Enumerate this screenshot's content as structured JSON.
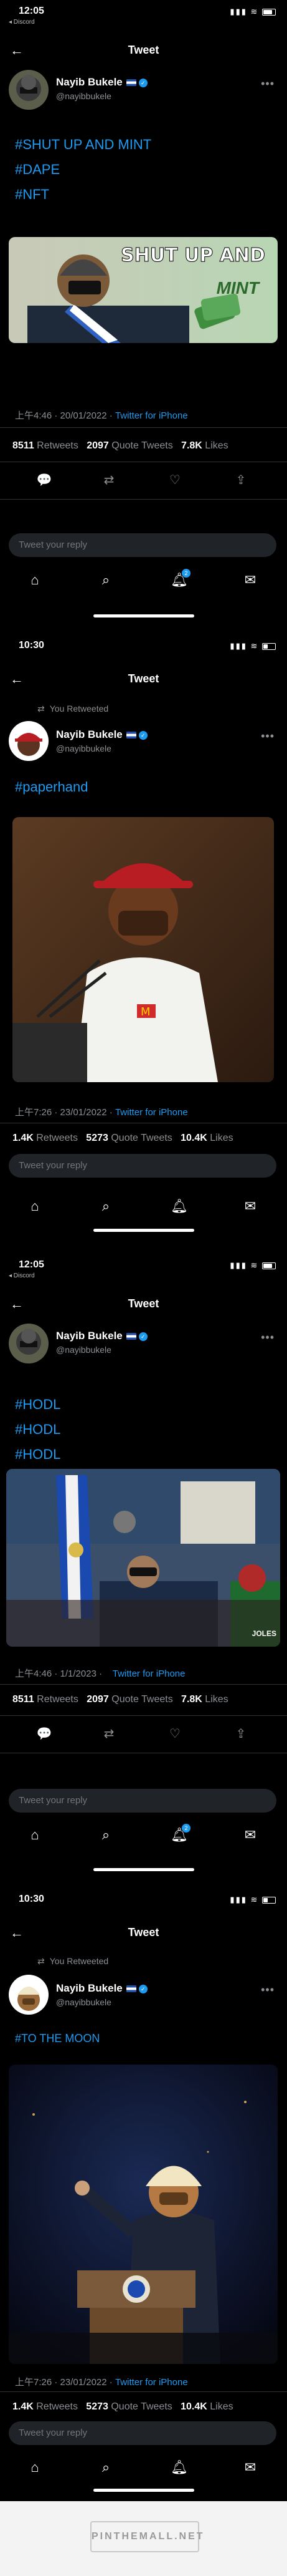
{
  "app": {
    "title": "Tweet",
    "reply_placeholder": "Tweet your reply"
  },
  "icons": {
    "back": "back-arrow-icon",
    "reply": "reply-icon",
    "retweet": "retweet-icon",
    "like": "heart-icon",
    "share": "share-icon",
    "home": "home-icon",
    "search": "search-icon",
    "notifications": "bell-icon",
    "messages": "mail-icon"
  },
  "colors": {
    "link": "#1d9bf0",
    "background": "#000000",
    "secondary_text": "#8b8f94"
  },
  "panels": [
    {
      "status_time": "12:05",
      "back_app": "◂ Discord",
      "retweeted": "",
      "name": "Nayib Bukele",
      "handle": "@nayibbukele",
      "hashtags": [
        "#SHUT UP AND MINT",
        "#DAPE",
        "#NFT"
      ],
      "image_caption_1": "SHUT UP AND",
      "image_caption_2": "MINT",
      "timestamp": "上午4:46 · 20/01/2022 ·",
      "source": "Twitter for iPhone",
      "retweets": "8511",
      "retweets_label": "Retweets",
      "quotes": "2097",
      "quotes_label": "Quote Tweets",
      "likes": "7.8K",
      "likes_label": "Likes",
      "notif_badge": "2"
    },
    {
      "status_time": "10:30",
      "retweeted": "You Retweeted",
      "name": "Nayib Bukele",
      "handle": "@nayibbukele",
      "hashtags": [
        "#paperhand"
      ],
      "timestamp": "上午7:26 · 23/01/2022 ·",
      "source": "Twitter for iPhone",
      "retweets": "1.4K",
      "retweets_label": "Retweets",
      "quotes": "5273",
      "quotes_label": "Quote Tweets",
      "likes": "10.4K",
      "likes_label": "Likes"
    },
    {
      "status_time": "12:05",
      "back_app": "◂ Discord",
      "retweeted": "",
      "name": "Nayib Bukele",
      "handle": "@nayibbukele",
      "hashtags": [
        "#HODL",
        "#HODL",
        "#HODL"
      ],
      "timestamp": "上午4:46 · 1/1/2023 ·",
      "source": "Twitter for iPhone",
      "retweets": "8511",
      "retweets_label": "Retweets",
      "quotes": "2097",
      "quotes_label": "Quote Tweets",
      "likes": "7.8K",
      "likes_label": "Likes",
      "notif_badge": "2"
    },
    {
      "status_time": "10:30",
      "retweeted": "You Retweeted",
      "name": "Nayib Bukele",
      "handle": "@nayibbukele",
      "hashtags": [
        "#TO THE MOON"
      ],
      "timestamp": "上午7:26 · 23/01/2022 ·",
      "source": "Twitter for iPhone",
      "retweets": "1.4K",
      "retweets_label": "Retweets",
      "quotes": "5273",
      "quotes_label": "Quote Tweets",
      "likes": "10.4K",
      "likes_label": "Likes"
    }
  ],
  "footer": {
    "watermark": "PINTHEMALL.NET"
  }
}
